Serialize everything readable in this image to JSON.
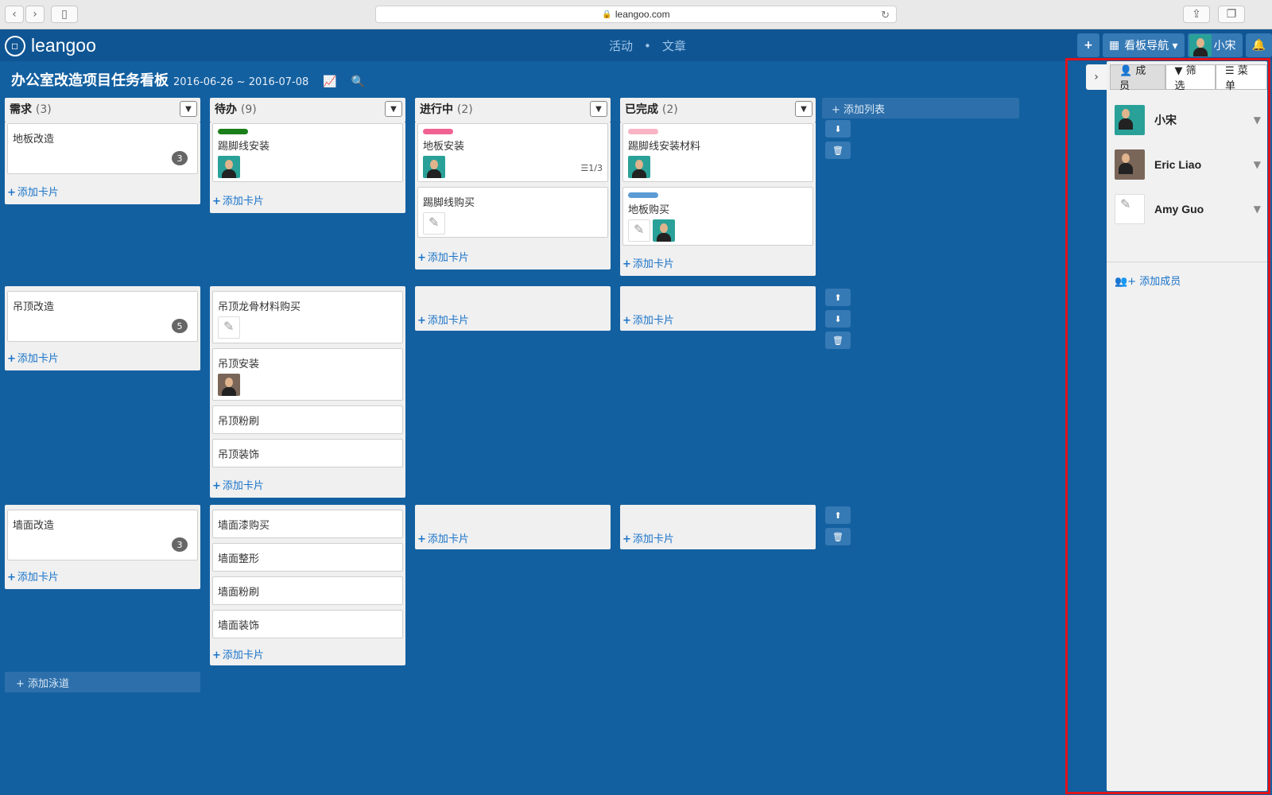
{
  "browser": {
    "url": "leangoo.com"
  },
  "app": {
    "logo_text": "leangoo",
    "logo_mark": "◇",
    "topnav": {
      "activity": "活动",
      "separator": "•",
      "articles": "文章"
    },
    "top_buttons": {
      "add": "+",
      "board_nav": "看板导航 ▾",
      "user": "小宋",
      "grid_icon": "▦",
      "bell_icon": "🔔"
    }
  },
  "board": {
    "title": "办公室改造项目任务看板",
    "dates": "2016-06-26 ~ 2016-07-08",
    "chart_icon": "📈",
    "search_icon": "🔍",
    "add_list": "+ 添加列表",
    "add_lane": "+ 添加泳道",
    "add_card": "添加卡片",
    "columns": [
      {
        "name": "需求",
        "count": "(3)"
      },
      {
        "name": "待办",
        "count": "(9)"
      },
      {
        "name": "进行中",
        "count": "(2)"
      },
      {
        "name": "已完成",
        "count": "(2)"
      }
    ],
    "cards": {
      "l1c1": {
        "title": "地板改造",
        "badge": "3"
      },
      "l1c2a": {
        "title": "踢脚线安装"
      },
      "l1c3a": {
        "title": "地板安装",
        "checklist": "☰1/3"
      },
      "l1c3b": {
        "title": "踢脚线购买"
      },
      "l1c4a": {
        "title": "踢脚线安装材料"
      },
      "l1c4b": {
        "title": "地板购买"
      },
      "l2c1": {
        "title": "吊顶改造",
        "badge": "5"
      },
      "l2c2a": {
        "title": "吊顶龙骨材料购买"
      },
      "l2c2b": {
        "title": "吊顶安装"
      },
      "l2c2c": {
        "title": "吊顶粉刷"
      },
      "l2c2d": {
        "title": "吊顶装饰"
      },
      "l3c1": {
        "title": "墙面改造",
        "badge": "3"
      },
      "l3c2a": {
        "title": "墙面漆购买"
      },
      "l3c2b": {
        "title": "墙面整形"
      },
      "l3c2c": {
        "title": "墙面粉刷"
      },
      "l3c2d": {
        "title": "墙面装饰"
      }
    },
    "label_colors": {
      "green": "#1a7f1a",
      "pink": "#f06292",
      "light_pink": "#f8b4c4",
      "blue": "#5b9bd5"
    }
  },
  "sidebar": {
    "toggle": "›",
    "tabs": {
      "members": "👤 成员",
      "filter": "▼ 筛选",
      "menu": "☰ 菜单"
    },
    "members": [
      {
        "name": "小宋"
      },
      {
        "name": "Eric Liao"
      },
      {
        "name": "Amy Guo"
      }
    ],
    "filter_icon": "▼",
    "add_member": "👥+ 添加成员"
  }
}
